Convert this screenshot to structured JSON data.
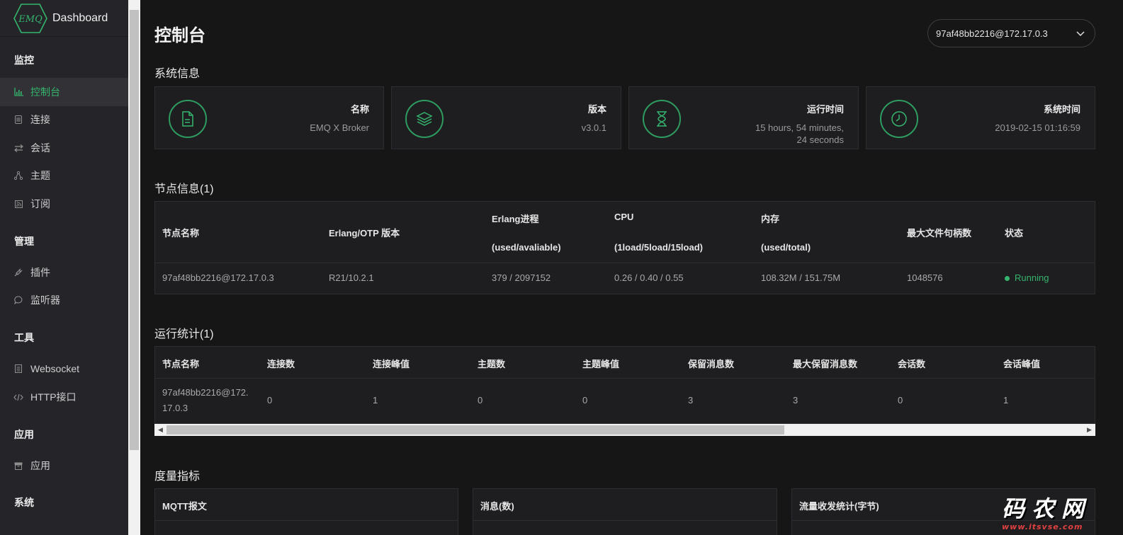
{
  "app": {
    "brand_logo_text": "EMQ",
    "brand_title": "Dashboard",
    "accent_color": "#35b56d"
  },
  "sidebar": {
    "groups": [
      {
        "title": "监控"
      },
      {
        "title": "管理"
      },
      {
        "title": "工具"
      },
      {
        "title": "应用"
      },
      {
        "title": "系统"
      }
    ],
    "items": [
      {
        "label": "控制台",
        "icon": "bar-chart-icon",
        "active": true
      },
      {
        "label": "连接",
        "icon": "server-icon"
      },
      {
        "label": "会话",
        "icon": "swap-arrows-icon"
      },
      {
        "label": "主题",
        "icon": "share-nodes-icon"
      },
      {
        "label": "订阅",
        "icon": "rss-icon"
      },
      {
        "label": "插件",
        "icon": "plug-icon"
      },
      {
        "label": "监听器",
        "icon": "chat-bubble-icon"
      },
      {
        "label": "Websocket",
        "icon": "document-icon"
      },
      {
        "label": "HTTP接口",
        "icon": "code-icon"
      },
      {
        "label": "应用",
        "icon": "archive-icon"
      }
    ]
  },
  "header": {
    "title": "控制台",
    "node_select_value": "97af48bb2216@172.17.0.3"
  },
  "system_info": {
    "title": "系统信息",
    "cards": [
      {
        "label": "名称",
        "value": "EMQ X Broker",
        "icon": "file-icon"
      },
      {
        "label": "版本",
        "value": "v3.0.1",
        "icon": "layers-icon"
      },
      {
        "label": "运行时间",
        "value_line1": "15 hours, 54 minutes,",
        "value_line2": "24 seconds",
        "icon": "hourglass-icon"
      },
      {
        "label": "系统时间",
        "value": "2019-02-15 01:16:59",
        "icon": "clock-icon"
      }
    ]
  },
  "node_info": {
    "title": "节点信息(1)",
    "columns": [
      {
        "line1": "节点名称"
      },
      {
        "line1": "Erlang/OTP 版本"
      },
      {
        "line1": "Erlang进程",
        "line2": "(used/avaliable)"
      },
      {
        "line1": "CPU",
        "line2": "(1load/5load/15load)"
      },
      {
        "line1": "内存",
        "line2": "(used/total)"
      },
      {
        "line1": "最大文件句柄数"
      },
      {
        "line1": "状态"
      }
    ],
    "row": [
      "97af48bb2216@172.17.0.3",
      "R21/10.2.1",
      "379 / 2097152",
      "0.26 / 0.40 / 0.55",
      "108.32M / 151.75M",
      "1048576",
      "Running"
    ]
  },
  "run_stats": {
    "title": "运行统计(1)",
    "columns": [
      "节点名称",
      "连接数",
      "连接峰值",
      "主题数",
      "主题峰值",
      "保留消息数",
      "最大保留消息数",
      "会话数",
      "会话峰值"
    ],
    "row_node_line1": "97af48bb2216@172.",
    "row_node_line2": "17.0.3",
    "row": [
      "0",
      "1",
      "0",
      "0",
      "3",
      "3",
      "0",
      "1"
    ]
  },
  "metrics": {
    "title": "度量指标",
    "cards": [
      "MQTT报文",
      "消息(数)",
      "流量收发统计(字节)"
    ]
  },
  "watermark": {
    "main": "码农网",
    "sub": "www.itsvse.com"
  }
}
